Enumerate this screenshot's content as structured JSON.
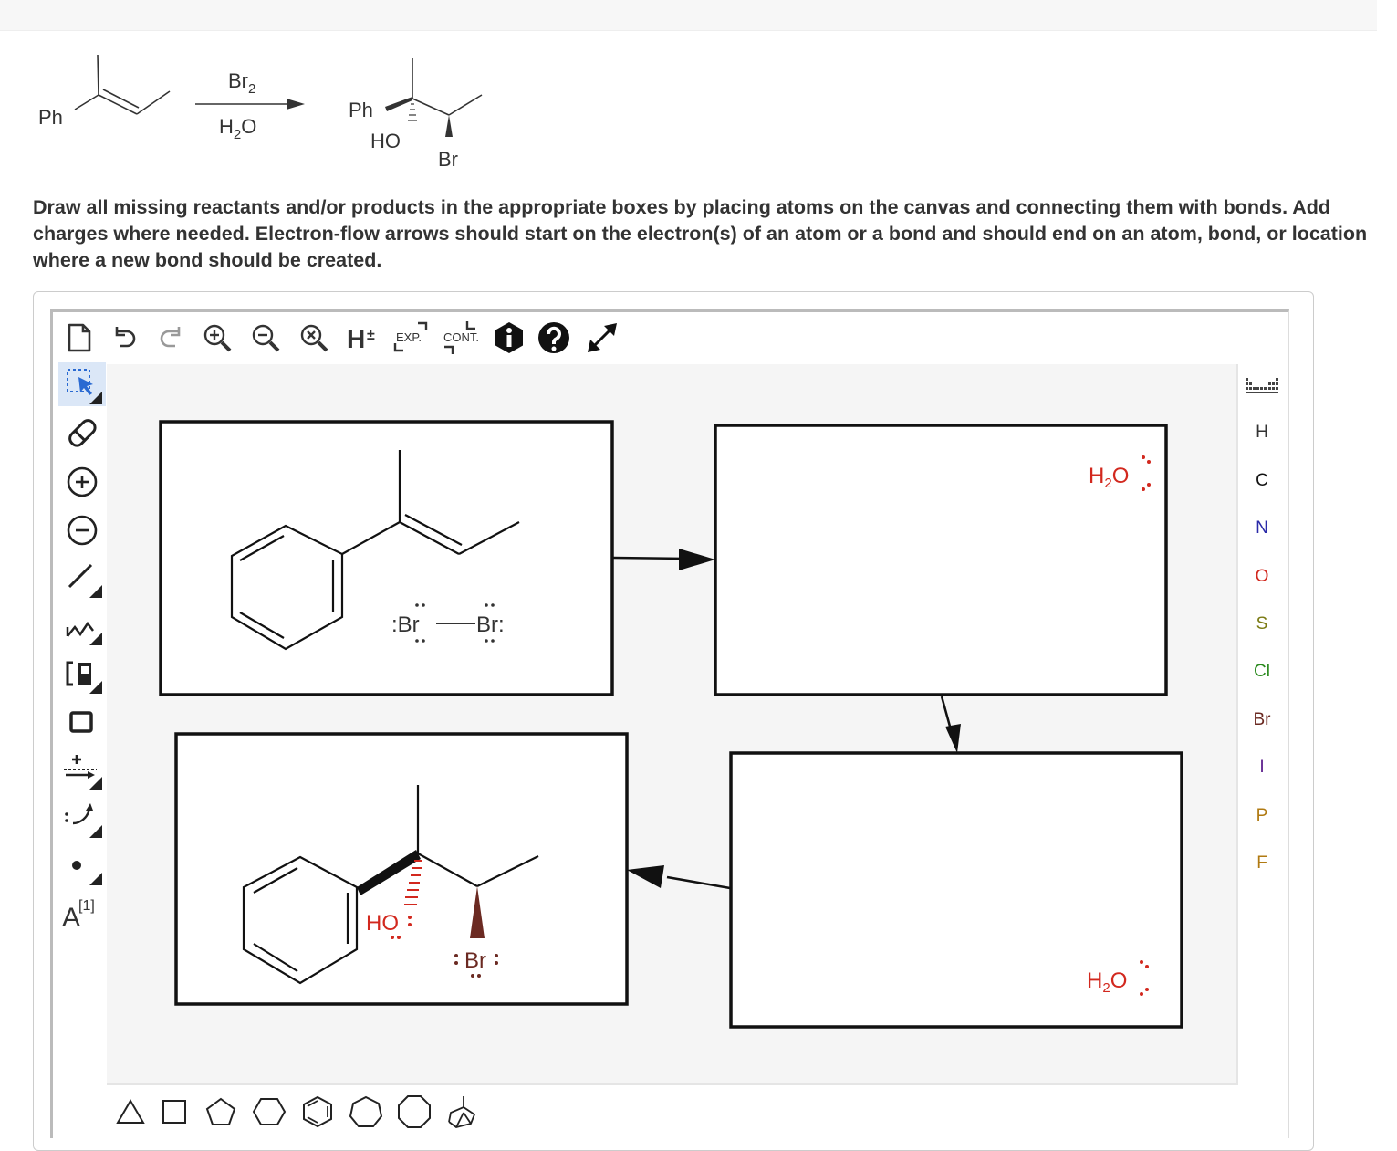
{
  "reaction": {
    "reactant_label": "Ph",
    "reagent_top": "Br",
    "reagent_top_sub": "2",
    "reagent_bottom_main": "H",
    "reagent_bottom_sub": "2",
    "reagent_bottom_tail": "O",
    "product_ph": "Ph",
    "product_ho": "HO",
    "product_br": "Br"
  },
  "instructions": "Draw all missing reactants and/or products in the appropriate boxes by placing atoms on the canvas and connecting them with bonds. Add charges where needed. Electron-flow arrows should start on the electron(s) of an atom or a bond and should end on an atom, bond, or location where a new bond should be created.",
  "toolbar": {
    "h_label": "H",
    "h_sign": "±",
    "exp_label": "EXP.",
    "cont_label": "CONT."
  },
  "left_tools": {
    "text_tool_label": "A",
    "text_tool_sup": "[1]"
  },
  "elements": [
    "H",
    "C",
    "N",
    "O",
    "S",
    "Cl",
    "Br",
    "I",
    "P",
    "F"
  ],
  "element_colors": {
    "H": "#333333",
    "C": "#111111",
    "N": "#2a2aa8",
    "O": "#d2281e",
    "S": "#7a7a12",
    "Cl": "#2a8a1e",
    "Br": "#6b2a22",
    "I": "#5a1a8a",
    "P": "#b07a12",
    "F": "#b07a12"
  },
  "canvas": {
    "br2_left": ":Br",
    "br2_right": "Br:",
    "water_top": {
      "h": "H",
      "sub": "2",
      "o": "O"
    },
    "water_bottom": {
      "h": "H",
      "sub": "2",
      "o": "O"
    },
    "product_ho": "HO",
    "product_br": "Br"
  },
  "colors": {
    "oxygen_red": "#d2281e",
    "bromine_brown": "#6b2a22",
    "active_tool_blue": "#2a6ad2"
  }
}
